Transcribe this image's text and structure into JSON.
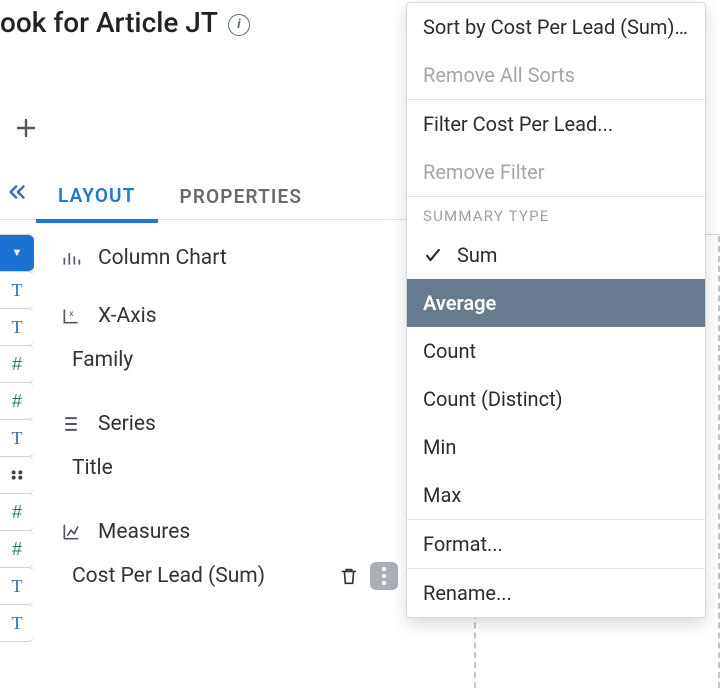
{
  "header": {
    "title": "ook for Article JT"
  },
  "tabs": {
    "layout": "LAYOUT",
    "properties": "PROPERTIES"
  },
  "layout": {
    "chart_type": "Column Chart",
    "xaxis_label": "X-Axis",
    "xaxis_field": "Family",
    "series_label": "Series",
    "series_field": "Title",
    "measures_label": "Measures",
    "measure_field": "Cost Per Lead (Sum)"
  },
  "menu": {
    "sort": "Sort by Cost Per Lead (Sum)...",
    "remove_sorts": "Remove All Sorts",
    "filter": "Filter Cost Per Lead...",
    "remove_filter": "Remove Filter",
    "summary_header": "SUMMARY TYPE",
    "sum": "Sum",
    "average": "Average",
    "count": "Count",
    "count_distinct": "Count (Distinct)",
    "min": "Min",
    "max": "Max",
    "format": "Format...",
    "rename": "Rename..."
  }
}
